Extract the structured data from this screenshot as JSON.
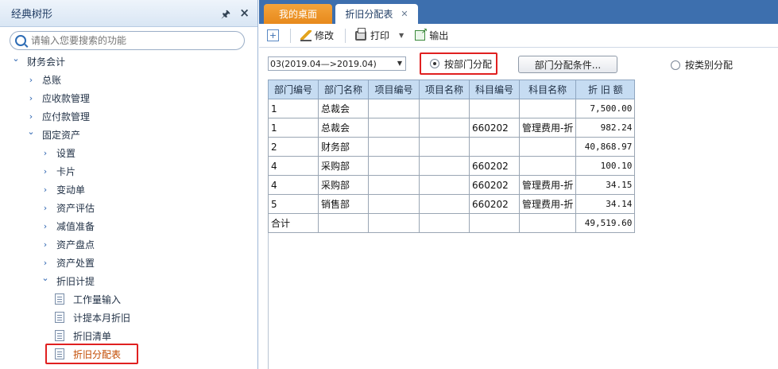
{
  "left_panel": {
    "title": "经典树形",
    "search_placeholder": "请输入您要搜索的功能",
    "tree": [
      {
        "label": "财务会计",
        "level": 0,
        "expanded": true
      },
      {
        "label": "总账",
        "level": 1,
        "expanded": false
      },
      {
        "label": "应收款管理",
        "level": 1,
        "expanded": false
      },
      {
        "label": "应付款管理",
        "level": 1,
        "expanded": false
      },
      {
        "label": "固定资产",
        "level": 1,
        "expanded": true
      },
      {
        "label": "设置",
        "level": 2,
        "expanded": false
      },
      {
        "label": "卡片",
        "level": 2,
        "expanded": false
      },
      {
        "label": "变动单",
        "level": 2,
        "expanded": false
      },
      {
        "label": "资产评估",
        "level": 2,
        "expanded": false
      },
      {
        "label": "减值准备",
        "level": 2,
        "expanded": false
      },
      {
        "label": "资产盘点",
        "level": 2,
        "expanded": false
      },
      {
        "label": "资产处置",
        "level": 2,
        "expanded": false
      },
      {
        "label": "折旧计提",
        "level": 2,
        "expanded": true
      },
      {
        "label": "工作量输入",
        "level": 3,
        "leaf": true
      },
      {
        "label": "计提本月折旧",
        "level": 3,
        "leaf": true
      },
      {
        "label": "折旧清单",
        "level": 3,
        "leaf": true
      },
      {
        "label": "折旧分配表",
        "level": 3,
        "leaf": true,
        "selected": true
      }
    ]
  },
  "tabs": [
    {
      "label": "我的桌面",
      "active": false
    },
    {
      "label": "折旧分配表",
      "active": true
    }
  ],
  "toolbar": {
    "edit_label": "修改",
    "print_label": "打印",
    "export_label": "输出"
  },
  "options": {
    "period_value": "03(2019.04—>2019.04)",
    "by_dept_label": "按部门分配",
    "dept_condition_label": "部门分配条件...",
    "by_category_label": "按类别分配"
  },
  "table": {
    "columns": [
      "部门编号",
      "部门名称",
      "项目编号",
      "项目名称",
      "科目编号",
      "科目名称",
      "折  旧  额"
    ],
    "rows": [
      [
        "1",
        "总裁会",
        "",
        "",
        "",
        "",
        "7,500.00"
      ],
      [
        "1",
        "总裁会",
        "",
        "",
        "660202",
        "管理费用-折",
        "982.24"
      ],
      [
        "2",
        "财务部",
        "",
        "",
        "",
        "",
        "40,868.97"
      ],
      [
        "4",
        "采购部",
        "",
        "",
        "660202",
        "",
        "100.10"
      ],
      [
        "4",
        "采购部",
        "",
        "",
        "660202",
        "管理费用-折",
        "34.15"
      ],
      [
        "5",
        "销售部",
        "",
        "",
        "660202",
        "管理费用-折",
        "34.14"
      ],
      [
        "合计",
        "",
        "",
        "",
        "",
        "",
        "49,519.60"
      ]
    ]
  },
  "colors": {
    "tabbar": "#3d6fae",
    "active_orange_tab": "#e7891c",
    "header_blue": "#c6dcf2",
    "highlight_red": "#e02020"
  }
}
